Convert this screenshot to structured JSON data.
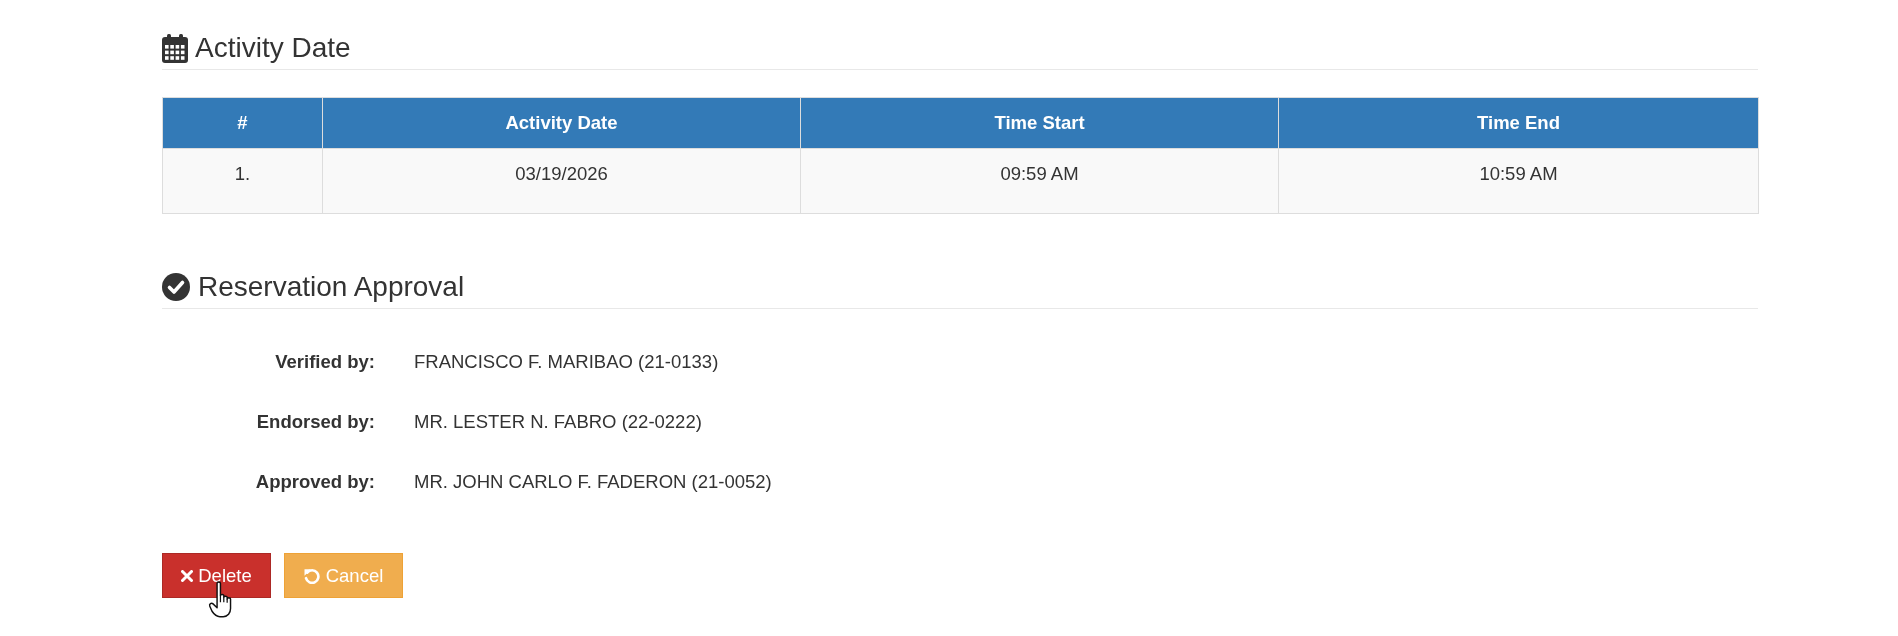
{
  "activity_date": {
    "title": "Activity Date",
    "table": {
      "columns": [
        "#",
        "Activity Date",
        "Time Start",
        "Time End"
      ],
      "rows": [
        [
          "1.",
          "03/19/2026",
          "09:59 AM",
          "10:59 AM"
        ]
      ]
    }
  },
  "reservation_approval": {
    "title": "Reservation Approval",
    "fields": [
      {
        "label": "Verified by:",
        "value": "FRANCISCO F. MARIBAO (21-0133)"
      },
      {
        "label": "Endorsed by:",
        "value": "MR. LESTER N. FABRO (22-0222)"
      },
      {
        "label": "Approved by:",
        "value": "MR. JOHN CARLO F. FADERON (21-0052)"
      }
    ]
  },
  "buttons": [
    {
      "kind": "delete",
      "label": "Delete"
    },
    {
      "kind": "cancel",
      "label": "Cancel"
    }
  ]
}
